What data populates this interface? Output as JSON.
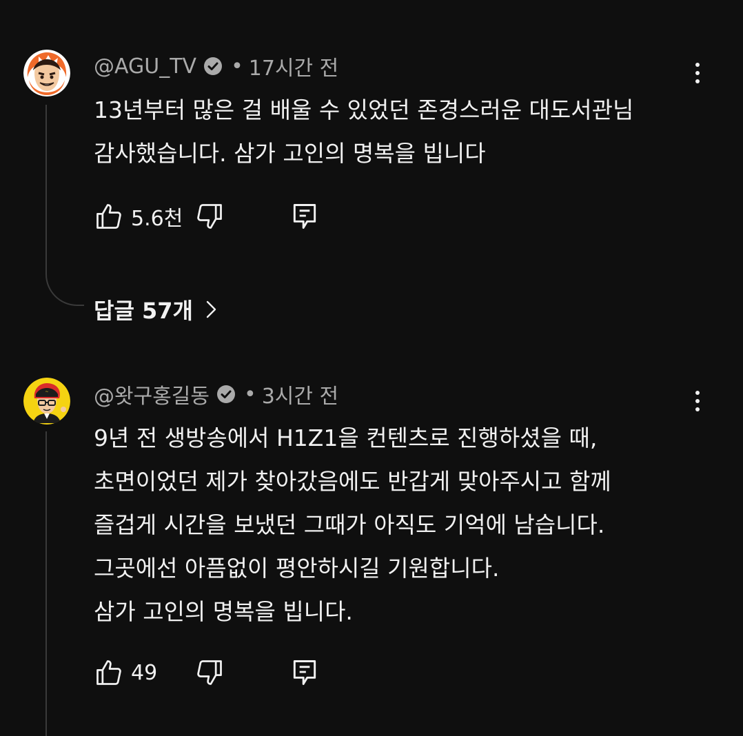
{
  "comments": [
    {
      "handle": "@AGU_TV",
      "verified": true,
      "separator": "•",
      "time": "17시간 전",
      "text_lines": [
        "13년부터 많은 걸 배울 수 있었던 존경스러운 대도서관님",
        "감사했습니다. 삼가 고인의 명복을 빕니다"
      ],
      "likes": "5.6천",
      "replies_label": "답글 57개",
      "avatar_icon": "cartoon-orange-hood-avatar"
    },
    {
      "handle": "@왓구홍길동",
      "verified": true,
      "separator": "•",
      "time": "3시간 전",
      "text_lines": [
        "9년 전 생방송에서 H1Z1을 컨텐츠로 진행하셨을 때,",
        "초면이었던 제가 찾아갔음에도 반갑게 맞아주시고 함께",
        "즐겁게 시간을 보냈던 그때가 아직도 기억에 남습니다.",
        "그곳에선 아픔없이 평안하시길 기원합니다.",
        "삼가 고인의 명복을 빕니다."
      ],
      "likes": "49",
      "avatar_icon": "cartoon-red-hair-yellow-avatar"
    }
  ],
  "icons": {
    "like": "thumbs-up-icon",
    "dislike": "thumbs-down-icon",
    "reply": "reply-comment-icon",
    "menu": "more-vertical-icon",
    "verified": "verified-check-icon",
    "chevron": "chevron-right-icon"
  },
  "colors": {
    "background": "#0f0f0f",
    "text_primary": "#f1f1f1",
    "text_secondary": "#aaaaaa",
    "thread_line": "#3a3a3a"
  }
}
